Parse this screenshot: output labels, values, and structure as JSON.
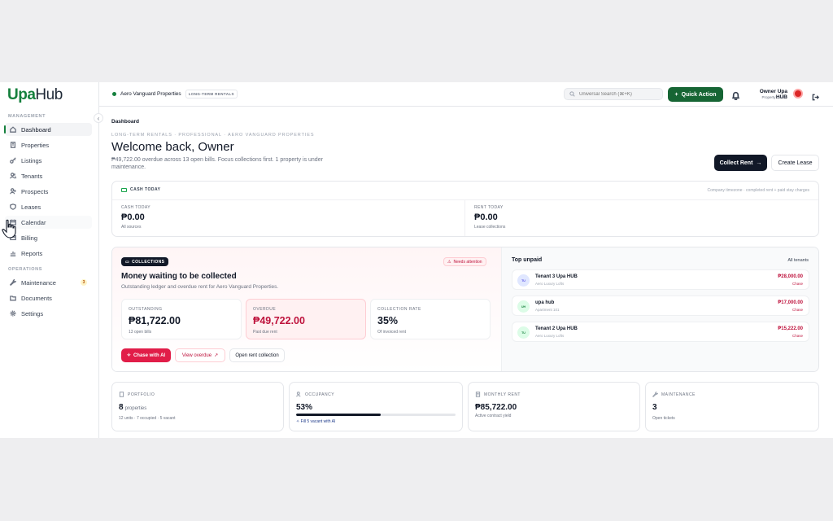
{
  "brand": {
    "part1": "Upa",
    "part2": "Hub"
  },
  "sidebar": {
    "management_label": "MANAGEMENT",
    "operations_label": "OPERATIONS",
    "management_items": [
      {
        "label": "Dashboard",
        "icon": "home-icon"
      },
      {
        "label": "Properties",
        "icon": "building-icon"
      },
      {
        "label": "Listings",
        "icon": "key-icon"
      },
      {
        "label": "Tenants",
        "icon": "users-icon"
      },
      {
        "label": "Prospects",
        "icon": "user-plus-icon"
      },
      {
        "label": "Leases",
        "icon": "shield-icon"
      },
      {
        "label": "Calendar",
        "icon": "calendar-icon"
      },
      {
        "label": "Billing",
        "icon": "card-icon"
      },
      {
        "label": "Reports",
        "icon": "chart-icon"
      }
    ],
    "operations_items": [
      {
        "label": "Maintenance",
        "icon": "wrench-icon",
        "badge": "3"
      },
      {
        "label": "Documents",
        "icon": "folder-icon"
      },
      {
        "label": "Settings",
        "icon": "gear-icon"
      }
    ]
  },
  "topbar": {
    "org_name": "Aero Vanguard Properties",
    "org_tag": "LONG-TERM RENTALS",
    "search_placeholder": "Universal Search (⌘+K)",
    "quick_action": "Quick Action",
    "user_name": "Owner Upa HUB",
    "user_role": "Property Owner"
  },
  "main": {
    "breadcrumb": "Dashboard",
    "overline": "LONG-TERM RENTALS · PROFESSIONAL · AERO VANGUARD PROPERTIES",
    "welcome": "Welcome back, Owner",
    "summary": "₱49,722.00 overdue across 13 open bills. Focus collections first. 1 property is under maintenance.",
    "collect_rent": "Collect Rent",
    "create_lease": "Create Lease"
  },
  "cash": {
    "header": "CASH TODAY",
    "note": "Company timezone · completed rent + paid stay charges",
    "today_label": "CASH TODAY",
    "today_value": "₱0.00",
    "today_sub": "All sources",
    "rent_label": "RENT TODAY",
    "rent_value": "₱0.00",
    "rent_sub": "Lease collections"
  },
  "collections": {
    "tag": "COLLECTIONS",
    "attention": "Needs attention",
    "title": "Money waiting to be collected",
    "subtitle": "Outstanding ledger and overdue rent for Aero Vanguard Properties.",
    "outstanding_label": "OUTSTANDING",
    "outstanding_value": "₱81,722.00",
    "outstanding_sub": "13 open bills",
    "overdue_label": "OVERDUE",
    "overdue_value": "₱49,722.00",
    "overdue_sub": "Past due rent",
    "rate_label": "COLLECTION RATE",
    "rate_value": "35%",
    "rate_sub": "Of invoiced rent",
    "chase_ai": "Chase with AI",
    "view_overdue": "View overdue",
    "open_collection": "Open rent collection"
  },
  "top_unpaid": {
    "title": "Top unpaid",
    "all_link": "All tenants",
    "tenants": [
      {
        "initials": "TU",
        "name": "Tenant 3 Upa HUB",
        "property": "Aero Luxury Lofts",
        "amount": "₱28,000.00",
        "action": "Chase"
      },
      {
        "initials": "UH",
        "name": "upa hub",
        "property": "Apartment 101",
        "amount": "₱17,000.00",
        "action": "Chase"
      },
      {
        "initials": "TU",
        "name": "Tenant 2 Upa HUB",
        "property": "Aero Luxury Lofts",
        "amount": "₱15,222.00",
        "action": "Chase"
      }
    ]
  },
  "kpis": {
    "portfolio": {
      "label": "PORTFOLIO",
      "value": "8",
      "unit": "properties",
      "sub": "12 units · 7 occupied · 5 vacant"
    },
    "occupancy": {
      "label": "OCCUPANCY",
      "value": "53%",
      "fill_percent": 53,
      "link": "Fill 5 vacant with AI"
    },
    "monthly_rent": {
      "label": "MONTHLY RENT",
      "value": "₱85,722.00",
      "sub": "Active contract yield"
    },
    "maintenance": {
      "label": "MAINTENANCE",
      "value": "3",
      "sub": "Open tickets"
    }
  },
  "colors": {
    "brand": "#15803d",
    "danger": "#e11d48",
    "dark": "#111827"
  }
}
